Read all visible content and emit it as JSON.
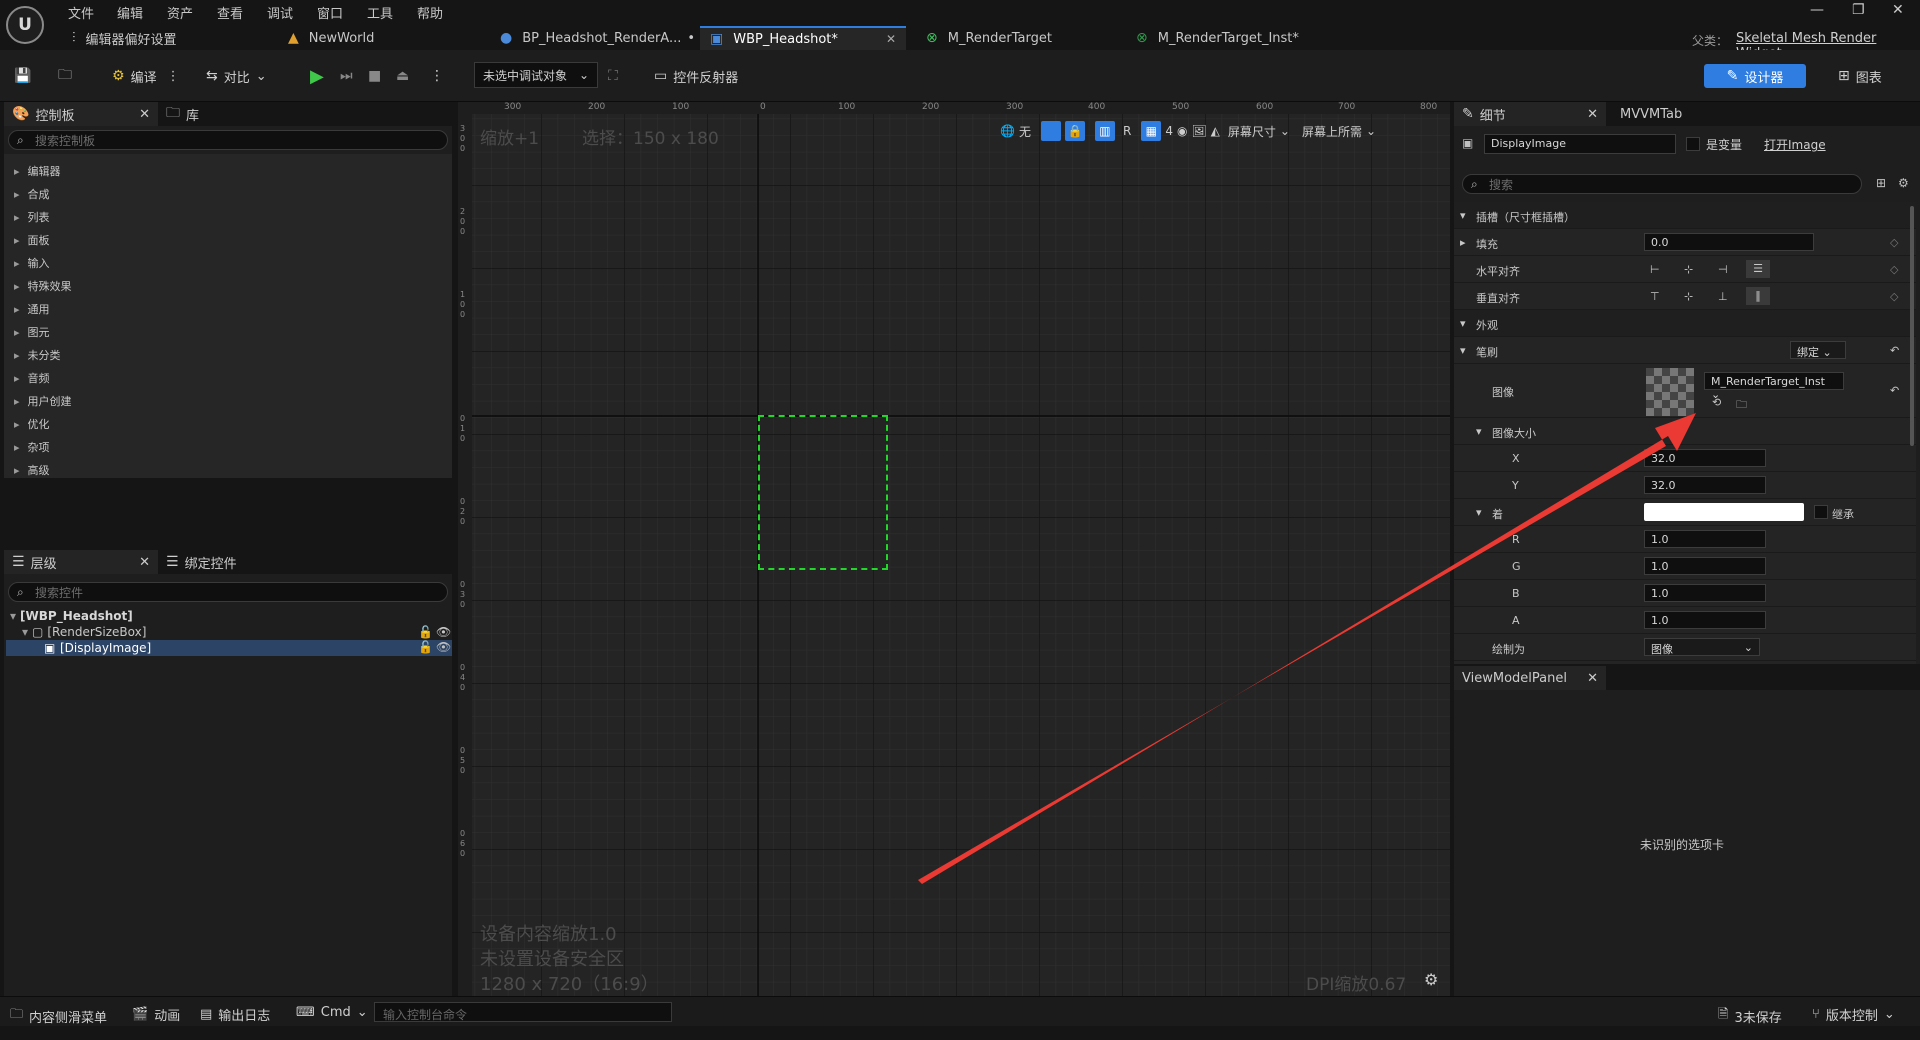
{
  "menu": [
    "文件",
    "编辑",
    "资产",
    "查看",
    "调试",
    "窗口",
    "工具",
    "帮助"
  ],
  "tabs": {
    "editor_prefs": "编辑器偏好设置",
    "newworld": "NewWorld",
    "bp": "BP_Headshot_RenderA...",
    "wbp": "WBP_Headshot*",
    "mrt": "M_RenderTarget",
    "mrt_inst": "M_RenderTarget_Inst*"
  },
  "parent": {
    "label": "父类：",
    "value": "Skeletal Mesh Render Widget"
  },
  "toolbar": {
    "compile": "编译",
    "diff": "对比",
    "debug_target": "未选中调试对象",
    "widget_reflector": "控件反射器",
    "designer": "设计器",
    "graph": "图表"
  },
  "palette": {
    "tab_palette": "控制板",
    "tab_library": "库",
    "search_placeholder": "搜索控制板",
    "categories": [
      "编辑器",
      "合成",
      "列表",
      "面板",
      "输入",
      "特殊效果",
      "通用",
      "图元",
      "未分类",
      "音频",
      "用户创建",
      "优化",
      "杂项",
      "高级"
    ]
  },
  "hierarchy": {
    "tab_hierarchy": "层级",
    "tab_bind": "绑定控件",
    "search_placeholder": "搜索控件",
    "root": "[WBP_Headshot]",
    "child": "[RenderSizeBox]",
    "leaf": "[DisplayImage]"
  },
  "viewport": {
    "zoom": "缩放+1",
    "selection": "选择：150 x 180",
    "none_label": "无",
    "r_label": "R",
    "grid_num": "4",
    "screen_size": "屏幕尺寸",
    "screen_fill": "屏幕上所需",
    "ruler_h": [
      "300",
      "200",
      "100",
      "0",
      "100",
      "200",
      "300",
      "400",
      "500",
      "600",
      "700",
      "800"
    ],
    "ruler_v": [
      "3",
      "0",
      "0",
      "2",
      "0",
      "0",
      "1",
      "0",
      "0",
      "0",
      "1",
      "0",
      "0",
      "2",
      "0",
      "0",
      "3",
      "0",
      "0",
      "4",
      "0",
      "0",
      "5",
      "0",
      "0",
      "6",
      "0",
      "0"
    ],
    "info": [
      "设备内容缩放1.0",
      "未设置设备安全区",
      "1280 x 720（16:9）"
    ],
    "dpi": "DPI缩放0.67"
  },
  "details": {
    "tab_details": "细节",
    "tab_mvvm": "MVVMTab",
    "name": "DisplayImage",
    "is_variable": "是变量",
    "open_link": "打开Image",
    "search_placeholder": "搜索",
    "slot": "插槽（尺寸框插槽）",
    "padding_label": "填充",
    "padding_value": "0.0",
    "halign_label": "水平对齐",
    "valign_label": "垂直对齐",
    "appearance": "外观",
    "brush": "笔刷",
    "bind": "绑定",
    "image_label": "图像",
    "image_value": "M_RenderTarget_Inst",
    "image_size": "图像大小",
    "x_label": "X",
    "x_value": "32.0",
    "y_label": "Y",
    "y_value": "32.0",
    "tint_label": "着",
    "inherit": "继承",
    "r_label": "R",
    "r_value": "1.0",
    "g_label": "G",
    "g_value": "1.0",
    "b_label": "B",
    "b_value": "1.0",
    "a_label": "A",
    "a_value": "1.0",
    "draw_as_label": "绘制为",
    "draw_as_value": "图像"
  },
  "viewmodel": {
    "tab": "ViewModelPanel",
    "message": "未识别的选项卡"
  },
  "statusbar": {
    "content_drawer": "内容侧滑菜单",
    "animation": "动画",
    "output_log": "输出日志",
    "cmd": "Cmd",
    "console_placeholder": "输入控制台命令",
    "unsaved": "3未保存",
    "source_control": "版本控制"
  },
  "colors": {
    "accent": "#2f7de1",
    "selection": "#22d62a",
    "arrow": "#ea3a33"
  }
}
